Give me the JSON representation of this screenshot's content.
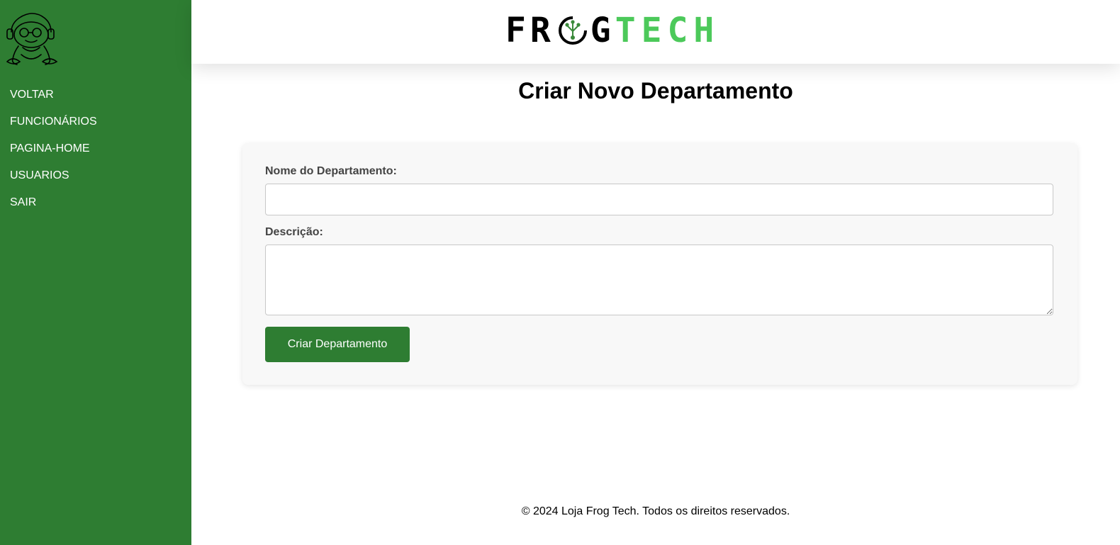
{
  "sidebar": {
    "nav": [
      "VOLTAR",
      "FUNCIONÁRIOS",
      "PAGINA-HOME",
      "USUARIOS",
      "SAIR"
    ]
  },
  "header": {
    "brand_dark": "FR",
    "brand_dark_2": "G",
    "brand_green": "TECH"
  },
  "main": {
    "title": "Criar Novo Departamento",
    "form": {
      "name_label": "Nome do Departamento:",
      "name_value": "",
      "desc_label": "Descrição:",
      "desc_value": "",
      "submit_label": "Criar Departamento"
    }
  },
  "footer": {
    "text": "© 2024 Loja Frog Tech. Todos os direitos reservados."
  },
  "colors": {
    "sidebar_bg": "#2e7d32",
    "brand_green": "#4cc95a",
    "button_bg": "#2e7d32"
  }
}
